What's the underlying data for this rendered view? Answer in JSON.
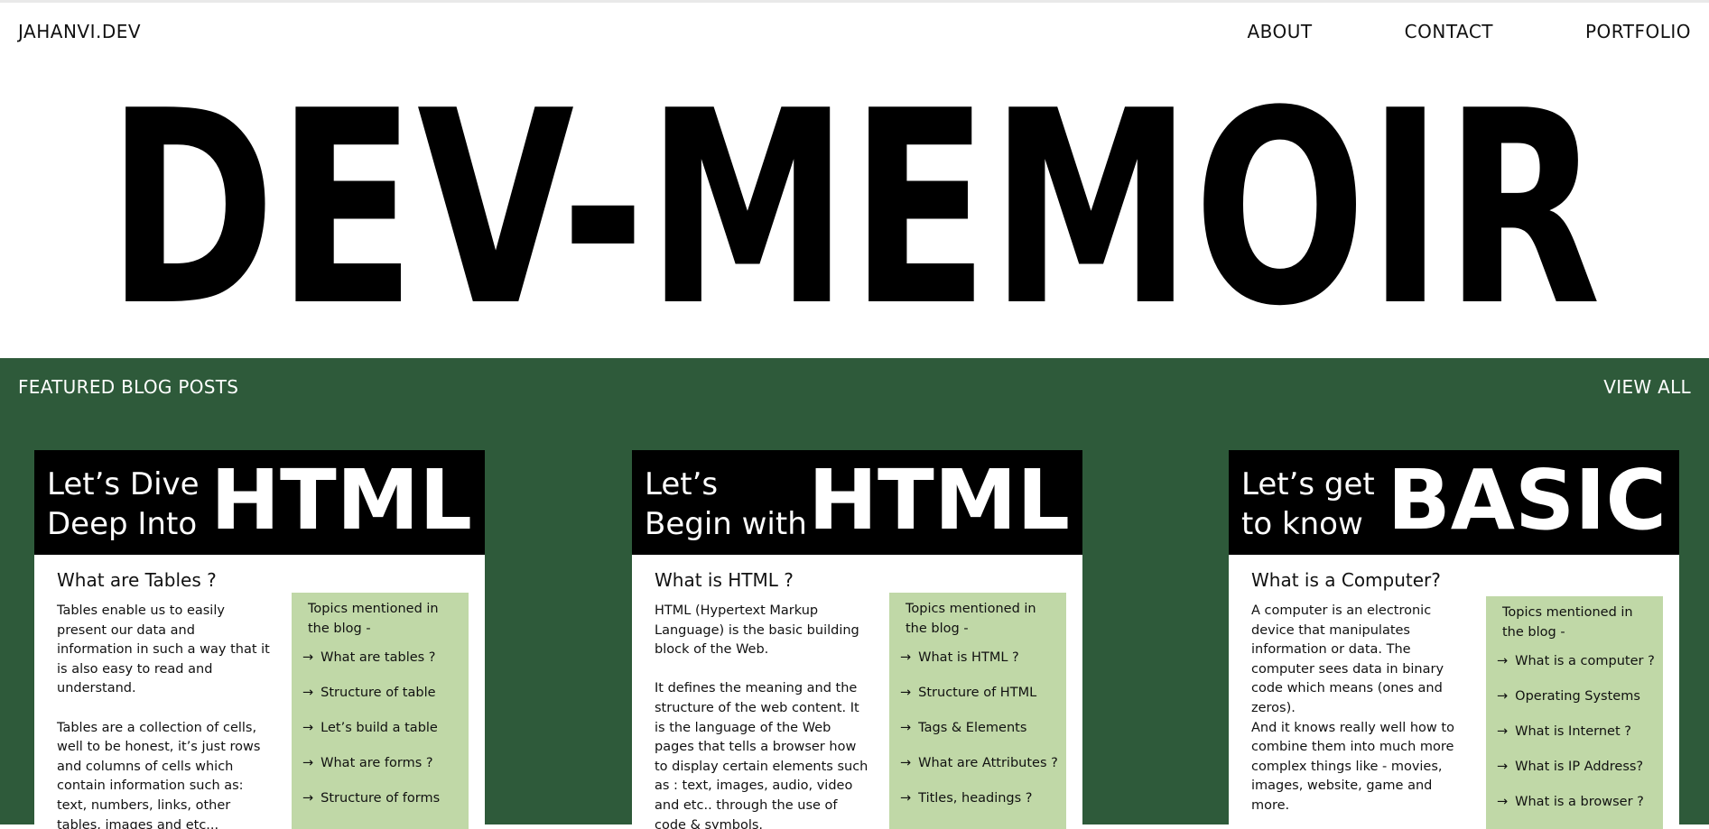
{
  "nav": {
    "brand": "JAHANVI.DEV",
    "links": [
      "ABOUT",
      "CONTACT",
      "PORTFOLIO"
    ]
  },
  "hero": {
    "title": "DEV-MEMOIR"
  },
  "featured": {
    "title": "FEATURED BLOG POSTS",
    "view_all": "VIEW ALL",
    "cards": [
      {
        "banner_small": "Let’s Dive\nDeep Into",
        "banner_big": "HTML",
        "heading": "What are Tables ?",
        "text": "Tables enable us to easily present our data and information in such a way that it is also easy to read and understand.\n\nTables are a collection of cells, well to be honest, it’s just rows and columns of cells which contain  information such as: text, numbers, links, other tables, images and etc...",
        "topics_title": "Topics mentioned in the blog -",
        "topics": [
          "What are tables ?",
          "Structure of table",
          "Let’s build a table",
          "What are forms ?",
          "Structure of forms"
        ]
      },
      {
        "banner_small": "Let’s\nBegin with",
        "banner_big": "HTML",
        "heading": "What is HTML ?",
        "text": "HTML (Hypertext Markup Language) is the basic building block of the Web.\n\n It defines the meaning and the structure of the web content. It is the language of the Web pages that tells a browser how to display certain elements such as : text, images, audio, video and etc.. through the use of code & symbols.",
        "topics_title": "Topics mentioned in the blog -",
        "topics": [
          "What is HTML ?",
          "Structure of HTML",
          "Tags & Elements",
          "What are Attributes ?",
          "Titles, headings ?"
        ]
      },
      {
        "banner_small": "Let’s get\nto know",
        "banner_big": "BASIC",
        "heading": "What is a Computer?",
        "text": "A computer is an electronic device that manipulates information or data. The computer sees data in binary code which means (ones and zeros).\nAnd it knows really well how to combine them into much more complex things like - movies, images, website, game and more.",
        "topics_title": "Topics mentioned in the blog -",
        "topics": [
          "What is a computer ?",
          "Operating Systems",
          "What is Internet ?",
          "What is IP Address?",
          "What is a browser ?"
        ]
      }
    ]
  }
}
